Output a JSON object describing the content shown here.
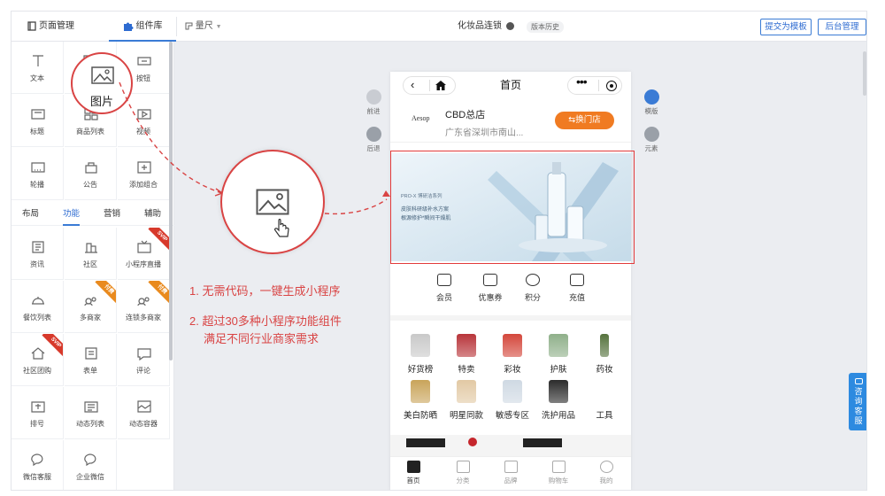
{
  "topbar": {
    "tab_pages": "页面管理",
    "tab_library": "组件库",
    "ruler": "量尺",
    "store_name": "化妆品连锁",
    "history": "版本历史",
    "submit_template": "提交为模板",
    "admin": "后台管理"
  },
  "sidebar": {
    "basic": [
      {
        "label": "文本",
        "icon": "text-icon"
      },
      {
        "label": "图片",
        "icon": "image-icon"
      },
      {
        "label": "按钮",
        "icon": "button-icon"
      },
      {
        "label": "标题",
        "icon": "title-icon"
      },
      {
        "label": "商品列表",
        "icon": "product-list-icon"
      },
      {
        "label": "视频",
        "icon": "video-icon"
      },
      {
        "label": "轮播",
        "icon": "carousel-icon"
      },
      {
        "label": "公告",
        "icon": "notice-icon"
      },
      {
        "label": "添加组合",
        "icon": "add-combo-icon"
      }
    ],
    "subtabs": [
      "布局",
      "功能",
      "营销",
      "辅助"
    ],
    "active_subtab": "功能",
    "functions": [
      {
        "label": "资讯",
        "icon": "news-icon"
      },
      {
        "label": "社区",
        "icon": "community-icon"
      },
      {
        "label": "小程序直播",
        "icon": "live-icon",
        "badge": "SVIP"
      },
      {
        "label": "餐饮列表",
        "icon": "dining-icon"
      },
      {
        "label": "多商家",
        "icon": "multi-merchant-icon",
        "badge": "付费"
      },
      {
        "label": "连锁多商家",
        "icon": "chain-merchant-icon",
        "badge": "付费"
      },
      {
        "label": "社区团购",
        "icon": "group-buy-icon",
        "badge": "SVIP"
      },
      {
        "label": "表单",
        "icon": "form-icon"
      },
      {
        "label": "评论",
        "icon": "comment-icon"
      },
      {
        "label": "排号",
        "icon": "queue-icon"
      },
      {
        "label": "动态列表",
        "icon": "dynamic-list-icon"
      },
      {
        "label": "动态容器",
        "icon": "dynamic-container-icon"
      },
      {
        "label": "微信客服",
        "icon": "wechat-service-icon"
      },
      {
        "label": "企业微信",
        "icon": "wecom-icon"
      }
    ],
    "zoom_label": "图片"
  },
  "canvas": {
    "forward": "前进",
    "back": "后退",
    "template": "模版",
    "element": "元素",
    "consult": "咨询客服"
  },
  "phone": {
    "title": "首页",
    "brand": "Aesop",
    "store": "CBD总店",
    "address": "广东省深圳市南山...",
    "switch_store": "⇆换门店",
    "banner_line1": "PRO-X 博研洁系列",
    "banner_line2": "皮肤科研级补水方案",
    "banner_line3": "根源修护*瞬间干燥肌",
    "quick": [
      "会员",
      "优惠券",
      "积分",
      "充值"
    ],
    "categories": [
      "好货榜",
      "特卖",
      "彩妆",
      "护肤",
      "药妆",
      "美白防晒",
      "明星同款",
      "敏感专区",
      "洗护用品",
      "工具"
    ],
    "tabbar": [
      "首页",
      "分类",
      "品牌",
      "购物车",
      "我的"
    ],
    "active_tab": "首页"
  },
  "annotations": {
    "point1": "1. 无需代码，一键生成小程序",
    "point2": "2. 超过30多种小程序功能组件",
    "point3": "满足不同行业商家需求"
  },
  "colors": {
    "accent": "#3a7bd5",
    "annotation_red": "#d94444",
    "switch_orange": "#f07b22",
    "svip_badge": "#d7392b",
    "paid_badge": "#e98a1e"
  }
}
